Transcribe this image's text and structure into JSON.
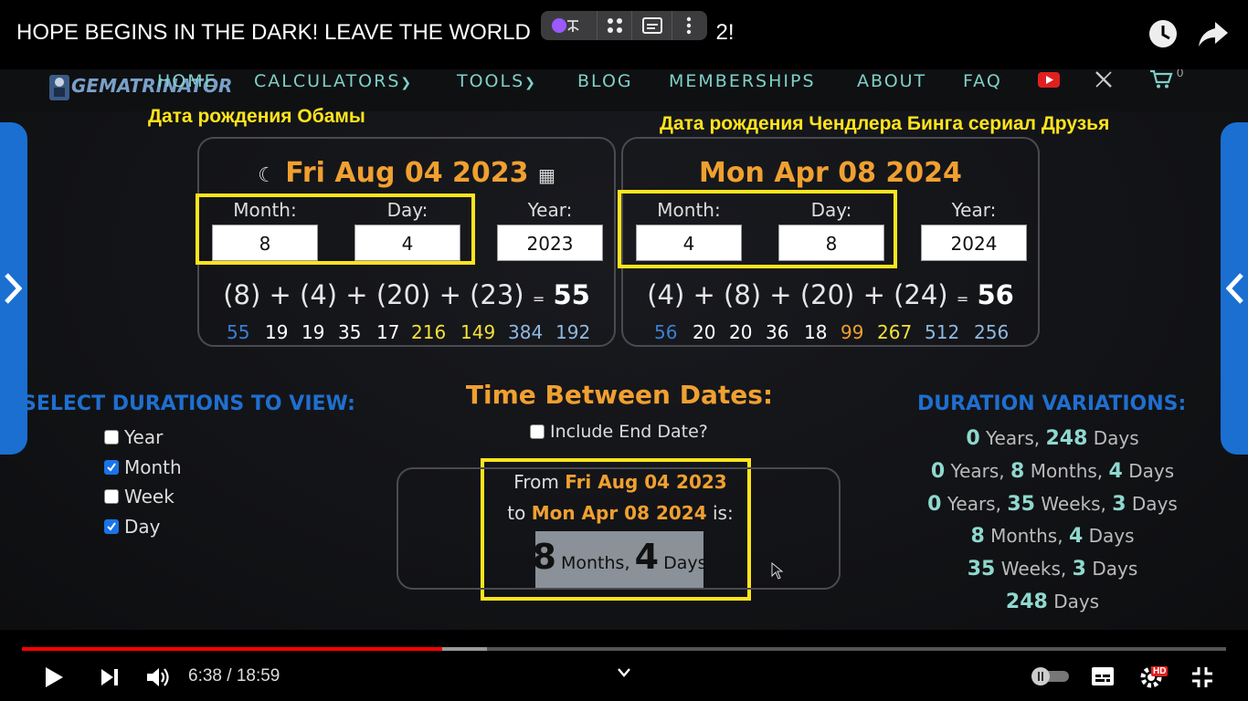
{
  "video": {
    "title": "HOPE BEGINS IN THE DARK! LEAVE THE WORLD",
    "title_tail": "2!"
  },
  "site": {
    "logo": "GEMATRINATOR",
    "nav": [
      "HOME",
      "CALCULATORS",
      "TOOLS",
      "BLOG",
      "MEMBERSHIPS",
      "ABOUT",
      "FAQ"
    ],
    "cart_count": "0"
  },
  "annotations": {
    "left": "Дата рождения Обамы",
    "right": "Дата рождения Чендлера Бинга сериал Друзья"
  },
  "panels": [
    {
      "date": "Fri Aug 04 2023",
      "month_label": "Month:",
      "day_label": "Day:",
      "year_label": "Year:",
      "month": "8",
      "day": "4",
      "year": "2023",
      "sum": "(8) + (4) + (20) + (23)",
      "eq": "=",
      "total": "55",
      "nums": [
        "55",
        "19",
        "19",
        "35",
        "17",
        "216",
        "149",
        "384",
        "192"
      ]
    },
    {
      "date": "Mon Apr 08 2024",
      "month_label": "Month:",
      "day_label": "Day:",
      "year_label": "Year:",
      "month": "4",
      "day": "8",
      "year": "2024",
      "sum": "(4) + (8) + (20) + (24)",
      "eq": "=",
      "total": "56",
      "nums": [
        "56",
        "20",
        "20",
        "36",
        "18",
        "99",
        "267",
        "512",
        "256"
      ]
    }
  ],
  "durations": {
    "title": "SELECT DURATIONS TO VIEW:",
    "options": [
      {
        "label": "Year",
        "checked": false
      },
      {
        "label": "Month",
        "checked": true
      },
      {
        "label": "Week",
        "checked": false
      },
      {
        "label": "Day",
        "checked": true
      }
    ]
  },
  "between": {
    "title": "Time Between Dates:",
    "include_end": "Include End Date?",
    "from_prefix": "From",
    "from_date": "Fri Aug 04 2023",
    "to_prefix": "to",
    "to_date": "Mon Apr 08 2024",
    "to_suffix": "is:",
    "result_months": "8",
    "result_months_unit": "Months,",
    "result_days": "4",
    "result_days_unit": "Days"
  },
  "variations": {
    "title": "DURATION VARIATIONS:",
    "rows": [
      {
        "n1": "0",
        "u1": "Years,",
        "n2": "248",
        "u2": "Days",
        "n3": "",
        "u3": ""
      },
      {
        "n1": "0",
        "u1": "Years,",
        "n2": "8",
        "u2": "Months,",
        "n3": "4",
        "u3": "Days"
      },
      {
        "n1": "0",
        "u1": "Years,",
        "n2": "35",
        "u2": "Weeks,",
        "n3": "3",
        "u3": "Days"
      },
      {
        "n1": "8",
        "u1": "Months,",
        "n2": "4",
        "u2": "Days",
        "n3": "",
        "u3": ""
      },
      {
        "n1": "35",
        "u1": "Weeks,",
        "n2": "3",
        "u2": "Days",
        "n3": "",
        "u3": ""
      },
      {
        "n1": "248",
        "u1": "Days",
        "n2": "",
        "u2": "",
        "n3": "",
        "u3": ""
      }
    ]
  },
  "player": {
    "time": "6:38 / 18:59",
    "played_fraction": 0.349,
    "buffered_fraction": 0.386,
    "hd_badge": "HD"
  },
  "colors": {
    "accent_orange": "#f0a030",
    "accent_blue": "#1f6fcf",
    "annotation_yellow": "#ffe41c",
    "progress_red": "#ff0000"
  }
}
